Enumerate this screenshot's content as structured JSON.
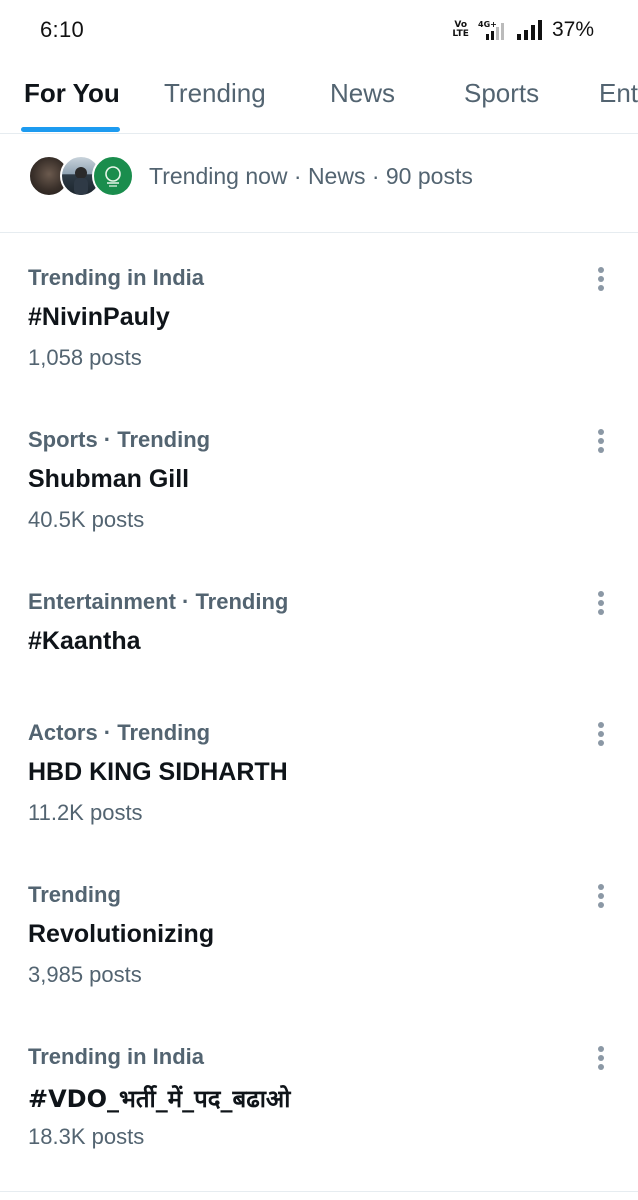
{
  "status_bar": {
    "time": "6:10",
    "volte_top": "Vo",
    "volte_bottom": "LTE",
    "network": "4G+",
    "battery": "37%"
  },
  "tabs": [
    {
      "label": "For You",
      "active": true
    },
    {
      "label": "Trending",
      "active": false
    },
    {
      "label": "News",
      "active": false
    },
    {
      "label": "Sports",
      "active": false
    },
    {
      "label": "Ent",
      "active": false
    }
  ],
  "trending_now": {
    "text": "Trending now · News · 90 posts"
  },
  "trends": [
    {
      "context": "Trending in India",
      "title": "#NivinPauly",
      "count": "1,058 posts"
    },
    {
      "context": "Sports · Trending",
      "title": "Shubman Gill",
      "count": "40.5K posts"
    },
    {
      "context": "Entertainment · Trending",
      "title": "#Kaantha",
      "count": ""
    },
    {
      "context": "Actors · Trending",
      "title": "HBD KING SIDHARTH",
      "count": "11.2K posts"
    },
    {
      "context": "Trending",
      "title": "Revolutionizing",
      "count": "3,985 posts"
    },
    {
      "context": "Trending in India",
      "title": "#VDO_भर्ती_में_पद_बढाओ",
      "count": "18.3K posts"
    }
  ],
  "colors": {
    "accent": "#1d9bf0",
    "primary_text": "#0f1419",
    "secondary_text": "#536471",
    "more_icon": "#8b98a5",
    "divider": "#e6ecf0"
  }
}
